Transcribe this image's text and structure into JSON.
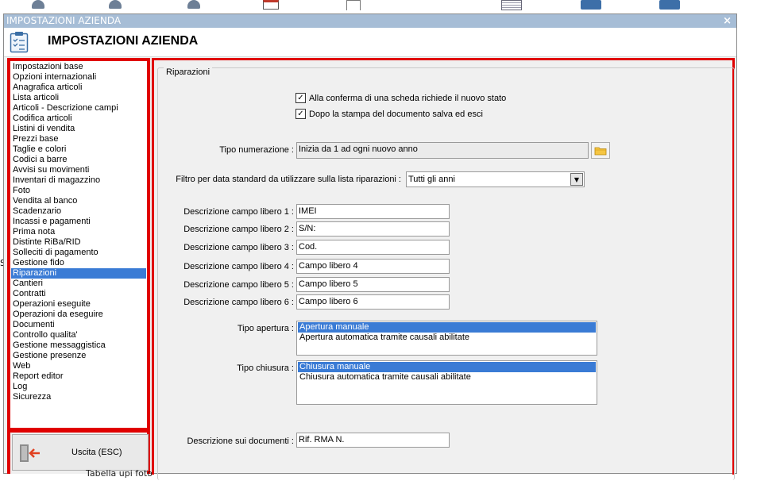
{
  "window": {
    "titlebar": "IMPOSTAZIONI AZIENDA",
    "close_glyph": "×",
    "header_title": "IMPOSTAZIONI AZIENDA"
  },
  "background": {
    "left_fragment": "S",
    "caption": "Tabella upi foto"
  },
  "nav": {
    "selected_index": 20,
    "items": [
      "Impostazioni base",
      "Opzioni internazionali",
      "Anagrafica articoli",
      "Lista articoli",
      "Articoli - Descrizione campi",
      "Codifica articoli",
      "Listini di vendita",
      "Prezzi base",
      "Taglie e colori",
      "Codici a barre",
      "Avvisi su movimenti",
      "Inventari di magazzino",
      "Foto",
      "Vendita al banco",
      "Scadenzario",
      "Incassi e pagamenti",
      "Prima nota",
      "Distinte RiBa/RID",
      "Solleciti di pagamento",
      "Gestione fido",
      "Riparazioni",
      "Cantieri",
      "Contratti",
      "Operazioni eseguite",
      "Operazioni da eseguire",
      "Documenti",
      "Controllo qualita'",
      "Gestione messaggistica",
      "Gestione presenze",
      "Web",
      "Report editor",
      "Log",
      "Sicurezza"
    ]
  },
  "exit": {
    "label": "Uscita (ESC)"
  },
  "main": {
    "group_title": "Riparazioni",
    "check_new_state": {
      "label": "Alla conferma di una scheda richiede il nuovo stato",
      "checked": true
    },
    "check_save_exit": {
      "label": "Dopo la stampa del documento salva ed esci",
      "checked": true
    },
    "numbering": {
      "label": "Tipo numerazione :",
      "value": "Inizia da 1 ad ogni nuovo anno"
    },
    "date_filter": {
      "label": "Filtro per data standard da utilizzare sulla lista riparazioni :",
      "value": "Tutti gli anni"
    },
    "free_fields": [
      {
        "label": "Descrizione campo libero 1 :",
        "value": "IMEI"
      },
      {
        "label": "Descrizione campo libero 2 :",
        "value": "S/N:"
      },
      {
        "label": "Descrizione campo libero 3 :",
        "value": "Cod."
      },
      {
        "label": "Descrizione campo libero 4 :",
        "value": "Campo libero 4"
      },
      {
        "label": "Descrizione campo libero 5 :",
        "value": "Campo libero 5"
      },
      {
        "label": "Descrizione campo libero 6 :",
        "value": "Campo libero 6"
      }
    ],
    "opening": {
      "label": "Tipo apertura :",
      "options": [
        "Apertura manuale",
        "Apertura automatica tramite causali abilitate"
      ],
      "selected": 0
    },
    "closing": {
      "label": "Tipo chiusura :",
      "options": [
        "Chiusura manuale",
        "Chiusura automatica tramite causali abilitate"
      ],
      "selected": 0
    },
    "doc_description": {
      "label": "Descrizione sui documenti :",
      "value": "Rif. RMA N."
    }
  },
  "colors": {
    "titlebar": "#a6bdd6",
    "highlight_border": "#e00000",
    "selection": "#3a7bd5"
  }
}
